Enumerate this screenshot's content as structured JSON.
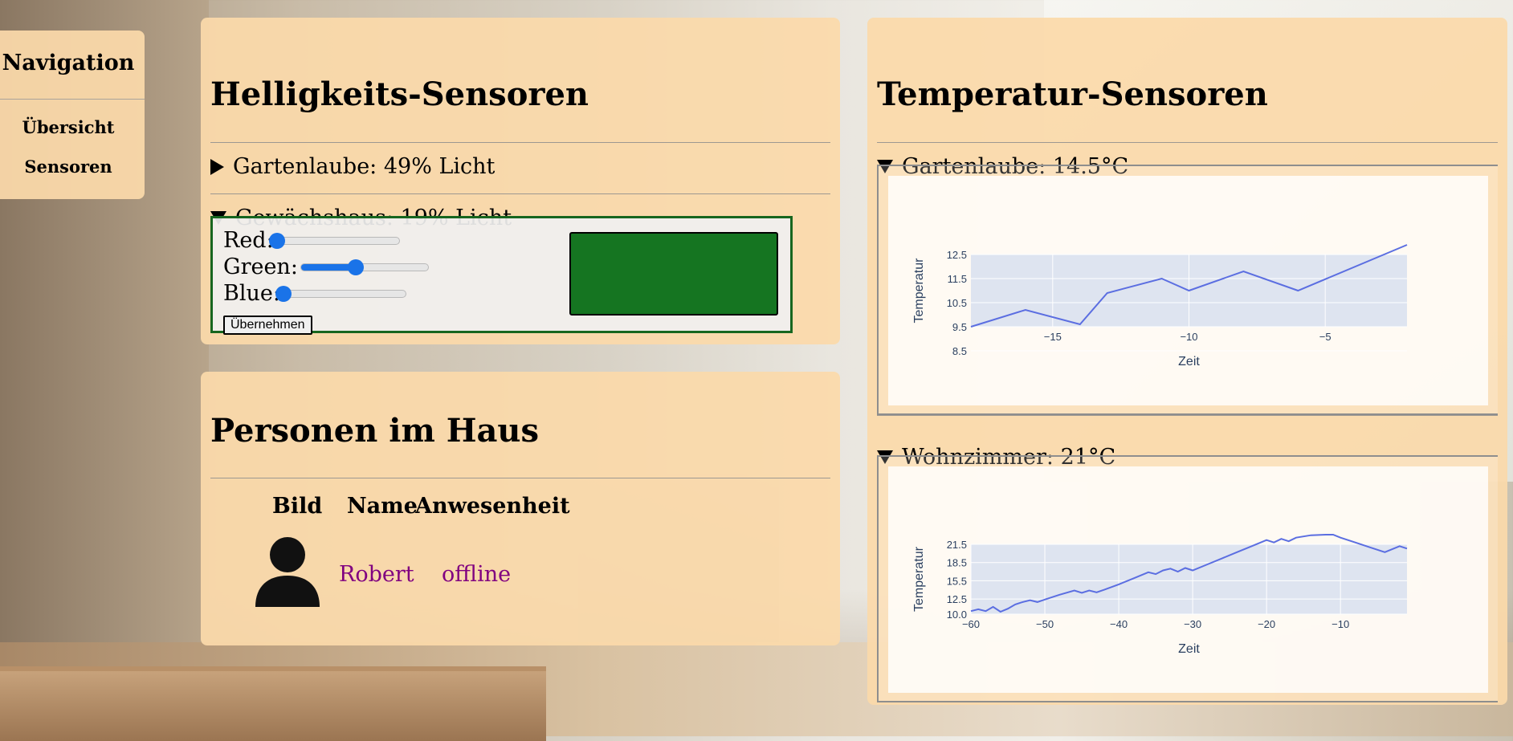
{
  "navigation": {
    "title": "Navigation",
    "items": [
      "Übersicht",
      "Sensoren"
    ]
  },
  "brightness": {
    "title": "Helligkeits-Sensoren",
    "sensors": [
      {
        "label": "Gartenlaube: 49% Licht",
        "expanded": false
      },
      {
        "label": "Gewächshaus: 19% Licht",
        "expanded": true
      }
    ],
    "controls": {
      "red_label": "Red:",
      "green_label": "Green:",
      "blue_label": "Blue:",
      "red_value": 0,
      "green_value": 0.43,
      "blue_value": 0,
      "apply_label": "Übernehmen",
      "swatch_color": "#157521"
    }
  },
  "persons": {
    "title": "Personen im Haus",
    "columns": [
      "Bild",
      "Name",
      "Anwesenheit"
    ],
    "rows": [
      {
        "name": "Robert",
        "status": "offline"
      }
    ]
  },
  "temperature": {
    "title": "Temperatur-Sensoren",
    "sensors": [
      {
        "label": "Gartenlaube: 14.5°C",
        "expanded": true
      },
      {
        "label": "Wohnzimmer: 21°C",
        "expanded": true
      }
    ]
  },
  "chart_data": [
    {
      "type": "line",
      "xlabel": "Zeit",
      "ylabel": "Temperatur",
      "xlim": [
        -18,
        -2
      ],
      "ylim": [
        9.5,
        12.5
      ],
      "xticks": [
        -15,
        -10,
        -5
      ],
      "yticks": [
        9.5,
        8.5,
        10.5,
        11.5,
        12.5
      ],
      "x": [
        -18,
        -16,
        -14,
        -13,
        -11,
        -10,
        -8,
        -6,
        -2
      ],
      "y": [
        9.5,
        10.2,
        9.6,
        10.9,
        11.5,
        11.0,
        11.8,
        11.0,
        13.0
      ],
      "color": "#5b6ee1"
    },
    {
      "type": "line",
      "xlabel": "Zeit",
      "ylabel": "Temperatur",
      "xlim": [
        -60,
        -1
      ],
      "ylim": [
        10.0,
        21.5
      ],
      "xticks": [
        -60,
        -50,
        -40,
        -30,
        -20,
        -10
      ],
      "yticks": [
        10.0,
        12.5,
        15.5,
        18.5,
        21.5
      ],
      "x": [
        -60,
        -59,
        -58,
        -57,
        -56,
        -55,
        -54,
        -53,
        -52,
        -51,
        -50,
        -48,
        -46,
        -45,
        -44,
        -43,
        -42,
        -40,
        -38,
        -36,
        -35,
        -34,
        -33,
        -32,
        -31,
        -30,
        -28,
        -26,
        -24,
        -22,
        -20,
        -19,
        -18,
        -17,
        -16,
        -14,
        -12,
        -11,
        -10,
        -8,
        -6,
        -4,
        -2,
        -1
      ],
      "y": [
        10.5,
        10.8,
        10.5,
        11.2,
        10.4,
        10.9,
        11.6,
        12.0,
        12.3,
        12.0,
        12.4,
        13.2,
        13.9,
        13.5,
        13.9,
        13.6,
        14.0,
        14.9,
        15.9,
        16.9,
        16.6,
        17.2,
        17.5,
        17.0,
        17.6,
        17.2,
        18.2,
        19.2,
        20.2,
        21.2,
        22.2,
        21.8,
        22.4,
        22.0,
        22.6,
        23.0,
        23.6,
        23.2,
        22.6,
        21.8,
        21.0,
        20.2,
        21.2,
        20.8
      ],
      "color": "#5b6ee1"
    }
  ]
}
